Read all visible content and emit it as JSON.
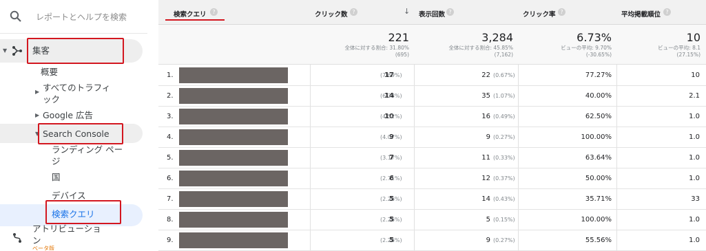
{
  "sidebar": {
    "search_placeholder": "レポートとヘルプを検索",
    "acquisition": "集客",
    "overview": "概要",
    "all_traffic_line1": "すべてのトラフィ",
    "all_traffic_line2": "ック",
    "google_ads": "Google 広告",
    "search_console": "Search Console",
    "landing_pages_line1": "ランディング ペー",
    "landing_pages_line2": "ジ",
    "countries": "国",
    "devices": "デバイス",
    "queries": "検索クエリ",
    "attribution_line1": "アトリビューショ",
    "attribution_line2": "ン",
    "beta": "ベータ版"
  },
  "table": {
    "headers": {
      "query": "検索クエリ",
      "clicks": "クリック数",
      "impressions": "表示回数",
      "ctr": "クリック率",
      "position": "平均掲載順位"
    },
    "totals": {
      "clicks": {
        "value": "221",
        "line1": "全体に対する割合: 31.80%",
        "line2": "(695)"
      },
      "impressions": {
        "value": "3,284",
        "line1": "全体に対する割合: 45.85%",
        "line2": "(7,162)"
      },
      "ctr": {
        "value": "6.73%",
        "line1": "ビューの平均: 9.70%",
        "line2": "(-30.65%)"
      },
      "position": {
        "value": "10",
        "line1": "ビューの平均: 8.1",
        "line2": "(27.15%)"
      }
    },
    "rows": [
      {
        "num": "1.",
        "clicks": "17",
        "clicks_pct": "(7.69%)",
        "impr": "22",
        "impr_pct": "(0.67%)",
        "ctr": "77.27%",
        "pos": "10"
      },
      {
        "num": "2.",
        "clicks": "14",
        "clicks_pct": "(6.33%)",
        "impr": "35",
        "impr_pct": "(1.07%)",
        "ctr": "40.00%",
        "pos": "2.1"
      },
      {
        "num": "3.",
        "clicks": "10",
        "clicks_pct": "(4.52%)",
        "impr": "16",
        "impr_pct": "(0.49%)",
        "ctr": "62.50%",
        "pos": "1.0"
      },
      {
        "num": "4.",
        "clicks": "9",
        "clicks_pct": "(4.07%)",
        "impr": "9",
        "impr_pct": "(0.27%)",
        "ctr": "100.00%",
        "pos": "1.0"
      },
      {
        "num": "5.",
        "clicks": "7",
        "clicks_pct": "(3.17%)",
        "impr": "11",
        "impr_pct": "(0.33%)",
        "ctr": "63.64%",
        "pos": "1.0"
      },
      {
        "num": "6.",
        "clicks": "6",
        "clicks_pct": "(2.71%)",
        "impr": "12",
        "impr_pct": "(0.37%)",
        "ctr": "50.00%",
        "pos": "1.0"
      },
      {
        "num": "7.",
        "clicks": "5",
        "clicks_pct": "(2.26%)",
        "impr": "14",
        "impr_pct": "(0.43%)",
        "ctr": "35.71%",
        "pos": "33"
      },
      {
        "num": "8.",
        "clicks": "5",
        "clicks_pct": "(2.26%)",
        "impr": "5",
        "impr_pct": "(0.15%)",
        "ctr": "100.00%",
        "pos": "1.0"
      },
      {
        "num": "9.",
        "clicks": "5",
        "clicks_pct": "(2.26%)",
        "impr": "9",
        "impr_pct": "(0.27%)",
        "ctr": "55.56%",
        "pos": "1.0"
      }
    ]
  },
  "colors": {
    "annotation_red": "#d3161f",
    "selected_text": "#1a73e8",
    "redaction": "#6b6563",
    "header_bg": "#f1f1f1"
  },
  "icons": [
    "search-icon",
    "acquisition-icon",
    "attribution-icon",
    "help-icon",
    "sort-down-icon",
    "caret-right-icon",
    "caret-down-icon"
  ]
}
